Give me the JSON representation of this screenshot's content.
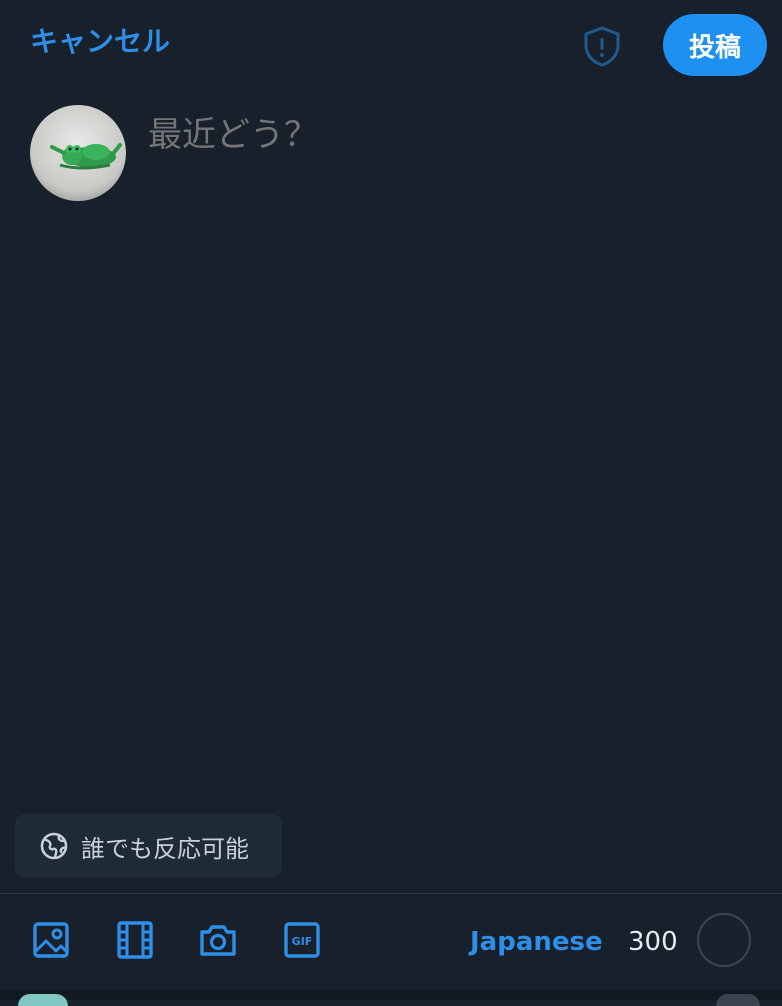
{
  "header": {
    "cancel_label": "キャンセル",
    "post_label": "投稿",
    "shield_icon": "shield-alert-icon"
  },
  "composer": {
    "placeholder": "最近どう？",
    "value": ""
  },
  "reply_setting": {
    "label": "誰でも反応可能",
    "icon": "globe-icon"
  },
  "toolbar": {
    "icons": [
      "image-icon",
      "video-icon",
      "camera-icon",
      "gif-icon"
    ],
    "language": "Japanese",
    "char_count": "300"
  },
  "colors": {
    "background": "#17202b",
    "accent": "#1d90f2",
    "link": "#2d8fe7",
    "placeholder": "#a9b4bf"
  }
}
